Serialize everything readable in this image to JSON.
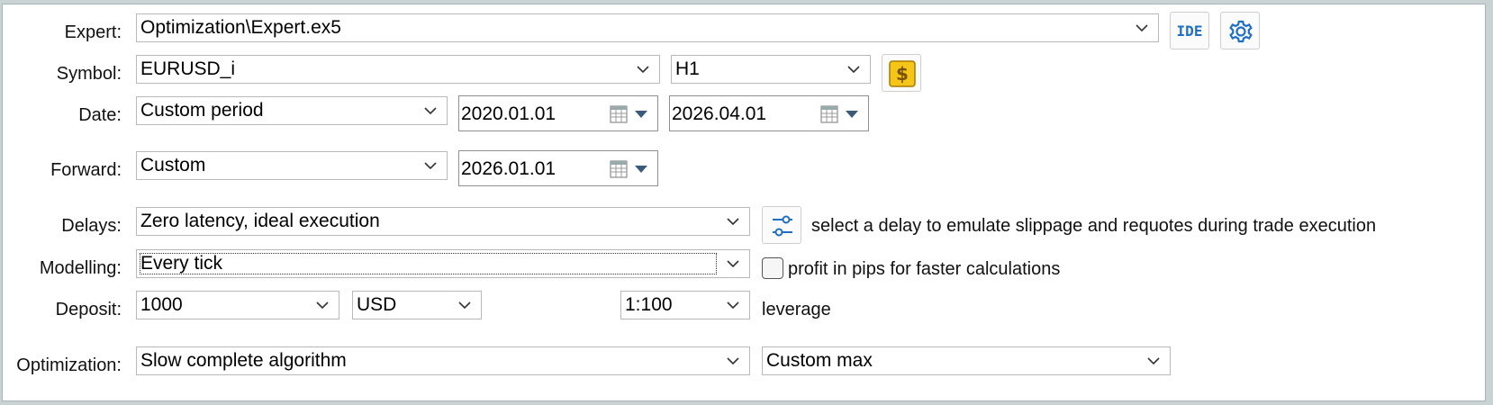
{
  "labels": {
    "expert": "Expert:",
    "symbol": "Symbol:",
    "date": "Date:",
    "forward": "Forward:",
    "delays": "Delays:",
    "modelling": "Modelling:",
    "deposit": "Deposit:",
    "optimization": "Optimization:"
  },
  "expert": {
    "value": "Optimization\\Expert.ex5",
    "ide_label": "IDE",
    "settings_icon": "gear-icon"
  },
  "symbol": {
    "value": "EURUSD_i",
    "timeframe": "H1",
    "spec_icon": "dollar-icon"
  },
  "date": {
    "mode": "Custom period",
    "from": "2020.01.01",
    "to": "2026.04.01"
  },
  "forward": {
    "mode": "Custom",
    "date": "2026.01.01"
  },
  "delays": {
    "value": "Zero latency, ideal execution",
    "settings_icon": "sliders-icon",
    "hint": "select a delay to emulate slippage and requotes during trade execution"
  },
  "modelling": {
    "value": "Every tick",
    "checkbox_label": "profit in pips for faster calculations",
    "checkbox_checked": false
  },
  "deposit": {
    "amount": "1000",
    "currency": "USD",
    "leverage_value": "1:100",
    "leverage_label": "leverage"
  },
  "optimization": {
    "algorithm": "Slow complete algorithm",
    "criterion": "Custom max"
  },
  "colors": {
    "accent": "#1f6fc5",
    "dollar_bg": "#f5c518",
    "frame": "#c9d3d3"
  }
}
